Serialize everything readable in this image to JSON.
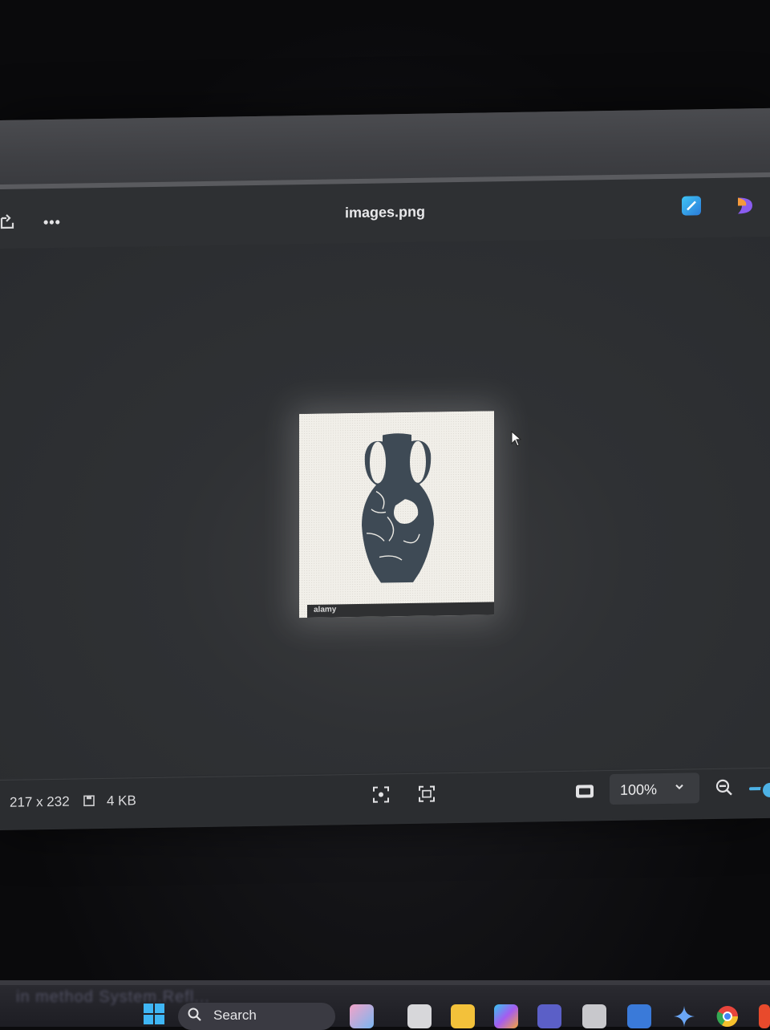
{
  "window": {
    "title": "images.png"
  },
  "image": {
    "watermark": "alamy"
  },
  "status": {
    "dimensions": "217 x 232",
    "file_size": "4 KB",
    "zoom": "100%"
  },
  "taskbar": {
    "search_label": "Search",
    "blur_text": "in method  System.Refl..."
  },
  "colors": {
    "accent": "#4db2e6",
    "vase": "#3e4a55"
  }
}
